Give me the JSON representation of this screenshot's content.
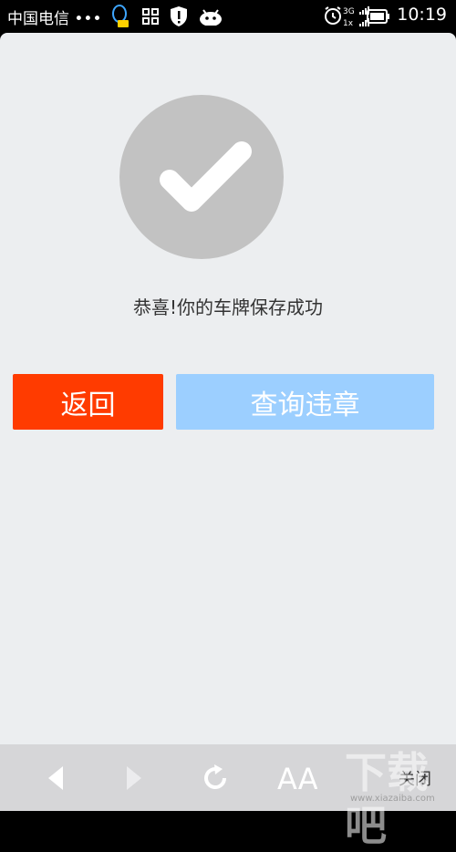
{
  "status_bar": {
    "carrier": "中国电信 •••",
    "time": "10:19",
    "network": "3G",
    "network_secondary": "1x"
  },
  "main": {
    "success_message": "恭喜!你的车牌保存成功",
    "back_label": "返回",
    "query_label": "查询违章"
  },
  "bottom_bar": {
    "font_label": "AA",
    "more_label": "关闭"
  },
  "watermark": {
    "text": "下载吧",
    "url": "www.xiazaiba.com"
  },
  "colors": {
    "back_button": "#ff3b00",
    "query_button": "#9ccfff",
    "page_bg": "#eceef0",
    "check_circle": "#c2c2c2"
  }
}
